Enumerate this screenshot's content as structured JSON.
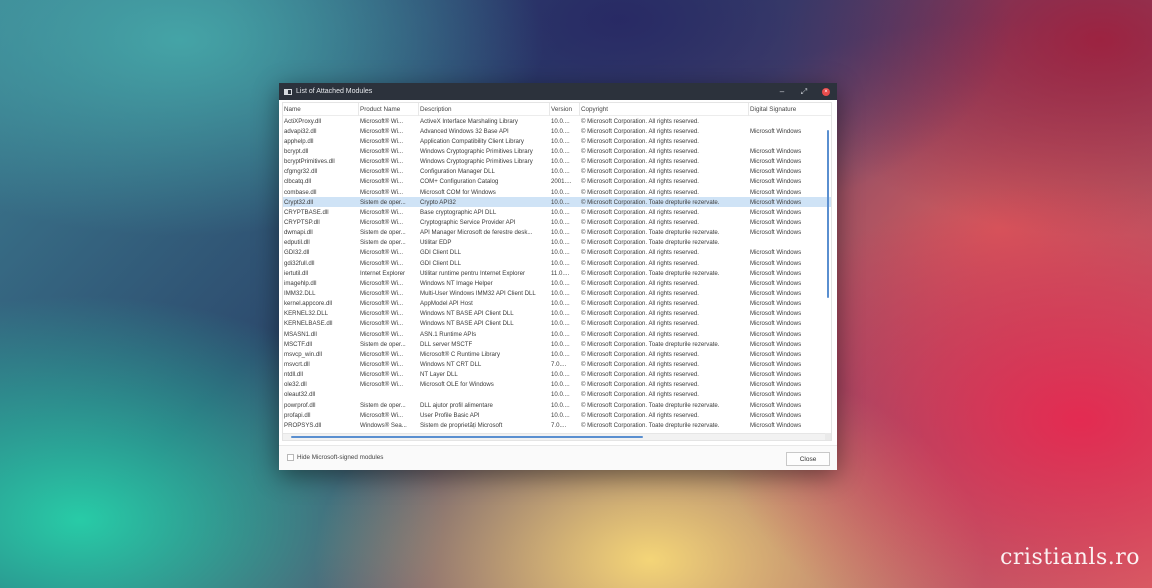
{
  "window": {
    "title": "List of Attached Modules",
    "minimize_glyph": "–",
    "maximize_glyph": "⤢",
    "close_glyph": "×"
  },
  "columns": [
    "Name",
    "Product Name",
    "Description",
    "Version",
    "Copyright",
    "Digital Signature"
  ],
  "rows": [
    {
      "name": "ActiXProxy.dll",
      "product": "Microsoft® Wi...",
      "description": "ActiveX Interface Marshaling Library",
      "version": "10.0....",
      "copyright": "© Microsoft Corporation. All rights reserved.",
      "signature": ""
    },
    {
      "name": "advapi32.dll",
      "product": "Microsoft® Wi...",
      "description": "Advanced Windows 32 Base API",
      "version": "10.0....",
      "copyright": "© Microsoft Corporation. All rights reserved.",
      "signature": "Microsoft Windows"
    },
    {
      "name": "apphelp.dll",
      "product": "Microsoft® Wi...",
      "description": "Application Compatibility Client Library",
      "version": "10.0....",
      "copyright": "© Microsoft Corporation. All rights reserved.",
      "signature": ""
    },
    {
      "name": "bcrypt.dll",
      "product": "Microsoft® Wi...",
      "description": "Windows Cryptographic Primitives Library",
      "version": "10.0....",
      "copyright": "© Microsoft Corporation. All rights reserved.",
      "signature": "Microsoft Windows"
    },
    {
      "name": "bcryptPrimitives.dll",
      "product": "Microsoft® Wi...",
      "description": "Windows Cryptographic Primitives Library",
      "version": "10.0....",
      "copyright": "© Microsoft Corporation. All rights reserved.",
      "signature": "Microsoft Windows"
    },
    {
      "name": "cfgmgr32.dll",
      "product": "Microsoft® Wi...",
      "description": "Configuration Manager DLL",
      "version": "10.0....",
      "copyright": "© Microsoft Corporation. All rights reserved.",
      "signature": "Microsoft Windows"
    },
    {
      "name": "clbcatq.dll",
      "product": "Microsoft® Wi...",
      "description": "COM+ Configuration Catalog",
      "version": "2001....",
      "copyright": "© Microsoft Corporation. All rights reserved.",
      "signature": "Microsoft Windows"
    },
    {
      "name": "combase.dll",
      "product": "Microsoft® Wi...",
      "description": "Microsoft COM for Windows",
      "version": "10.0....",
      "copyright": "© Microsoft Corporation. All rights reserved.",
      "signature": "Microsoft Windows"
    },
    {
      "name": "Crypt32.dll",
      "product": "Sistem de oper...",
      "description": "Crypto API32",
      "version": "10.0....",
      "copyright": "© Microsoft Corporation. Toate drepturile rezervate.",
      "signature": "Microsoft Windows",
      "selected": true
    },
    {
      "name": "CRYPTBASE.dll",
      "product": "Microsoft® Wi...",
      "description": "Base cryptographic API DLL",
      "version": "10.0....",
      "copyright": "© Microsoft Corporation. All rights reserved.",
      "signature": "Microsoft Windows"
    },
    {
      "name": "CRYPTSP.dll",
      "product": "Microsoft® Wi...",
      "description": "Cryptographic Service Provider API",
      "version": "10.0....",
      "copyright": "© Microsoft Corporation. All rights reserved.",
      "signature": "Microsoft Windows"
    },
    {
      "name": "dwmapi.dll",
      "product": "Sistem de oper...",
      "description": "API Manager Microsoft de ferestre desk...",
      "version": "10.0....",
      "copyright": "© Microsoft Corporation. Toate drepturile rezervate.",
      "signature": "Microsoft Windows"
    },
    {
      "name": "edputil.dll",
      "product": "Sistem de oper...",
      "description": "Utilitar EDP",
      "version": "10.0....",
      "copyright": "© Microsoft Corporation. Toate drepturile rezervate.",
      "signature": ""
    },
    {
      "name": "GDI32.dll",
      "product": "Microsoft® Wi...",
      "description": "GDI Client DLL",
      "version": "10.0....",
      "copyright": "© Microsoft Corporation. All rights reserved.",
      "signature": "Microsoft Windows"
    },
    {
      "name": "gdi32full.dll",
      "product": "Microsoft® Wi...",
      "description": "GDI Client DLL",
      "version": "10.0....",
      "copyright": "© Microsoft Corporation. All rights reserved.",
      "signature": "Microsoft Windows"
    },
    {
      "name": "iertutil.dll",
      "product": "Internet Explorer",
      "description": "Utilitar runtime pentru Internet Explorer",
      "version": "11.0....",
      "copyright": "© Microsoft Corporation. Toate drepturile rezervate.",
      "signature": "Microsoft Windows"
    },
    {
      "name": "imagehlp.dll",
      "product": "Microsoft® Wi...",
      "description": "Windows NT Image Helper",
      "version": "10.0....",
      "copyright": "© Microsoft Corporation. All rights reserved.",
      "signature": "Microsoft Windows"
    },
    {
      "name": "IMM32.DLL",
      "product": "Microsoft® Wi...",
      "description": "Multi-User Windows IMM32 API Client DLL",
      "version": "10.0....",
      "copyright": "© Microsoft Corporation. All rights reserved.",
      "signature": "Microsoft Windows"
    },
    {
      "name": "kernel.appcore.dll",
      "product": "Microsoft® Wi...",
      "description": "AppModel API Host",
      "version": "10.0....",
      "copyright": "© Microsoft Corporation. All rights reserved.",
      "signature": "Microsoft Windows"
    },
    {
      "name": "KERNEL32.DLL",
      "product": "Microsoft® Wi...",
      "description": "Windows NT BASE API Client DLL",
      "version": "10.0....",
      "copyright": "© Microsoft Corporation. All rights reserved.",
      "signature": "Microsoft Windows"
    },
    {
      "name": "KERNELBASE.dll",
      "product": "Microsoft® Wi...",
      "description": "Windows NT BASE API Client DLL",
      "version": "10.0....",
      "copyright": "© Microsoft Corporation. All rights reserved.",
      "signature": "Microsoft Windows"
    },
    {
      "name": "MSASN1.dll",
      "product": "Microsoft® Wi...",
      "description": "ASN.1 Runtime APIs",
      "version": "10.0....",
      "copyright": "© Microsoft Corporation. All rights reserved.",
      "signature": "Microsoft Windows"
    },
    {
      "name": "MSCTF.dll",
      "product": "Sistem de oper...",
      "description": "DLL server MSCTF",
      "version": "10.0....",
      "copyright": "© Microsoft Corporation. Toate drepturile rezervate.",
      "signature": "Microsoft Windows"
    },
    {
      "name": "msvcp_win.dll",
      "product": "Microsoft® Wi...",
      "description": "Microsoft® C Runtime Library",
      "version": "10.0....",
      "copyright": "© Microsoft Corporation. All rights reserved.",
      "signature": "Microsoft Windows"
    },
    {
      "name": "msvcrt.dll",
      "product": "Microsoft® Wi...",
      "description": "Windows NT CRT DLL",
      "version": "7.0....",
      "copyright": "© Microsoft Corporation. All rights reserved.",
      "signature": "Microsoft Windows"
    },
    {
      "name": "ntdll.dll",
      "product": "Microsoft® Wi...",
      "description": "NT Layer DLL",
      "version": "10.0....",
      "copyright": "© Microsoft Corporation. All rights reserved.",
      "signature": "Microsoft Windows"
    },
    {
      "name": "ole32.dll",
      "product": "Microsoft® Wi...",
      "description": "Microsoft OLE for Windows",
      "version": "10.0....",
      "copyright": "© Microsoft Corporation. All rights reserved.",
      "signature": "Microsoft Windows"
    },
    {
      "name": "oleaut32.dll",
      "product": "",
      "description": "",
      "version": "10.0....",
      "copyright": "© Microsoft Corporation. All rights reserved.",
      "signature": "Microsoft Windows"
    },
    {
      "name": "powrprof.dll",
      "product": "Sistem de oper...",
      "description": "DLL ajutor profil alimentare",
      "version": "10.0....",
      "copyright": "© Microsoft Corporation. Toate drepturile rezervate.",
      "signature": "Microsoft Windows"
    },
    {
      "name": "profapi.dll",
      "product": "Microsoft® Wi...",
      "description": "User Profile Basic API",
      "version": "10.0....",
      "copyright": "© Microsoft Corporation. All rights reserved.",
      "signature": "Microsoft Windows"
    },
    {
      "name": "PROPSYS.dll",
      "product": "Windows® Sea...",
      "description": "Sistem de proprietăți Microsoft",
      "version": "7.0....",
      "copyright": "© Microsoft Corporation. Toate drepturile rezervate.",
      "signature": "Microsoft Windows"
    }
  ],
  "footer": {
    "checkbox_label": "Hide Microsoft-signed modules",
    "checkbox_checked": false,
    "close_label": "Close"
  },
  "watermark": "cristianls.ro",
  "colors": {
    "titlebar": "#2c323c",
    "selection": "#cfe3f6",
    "scrollbar": "#5a8fd0",
    "close_dot": "#e84b4b"
  }
}
